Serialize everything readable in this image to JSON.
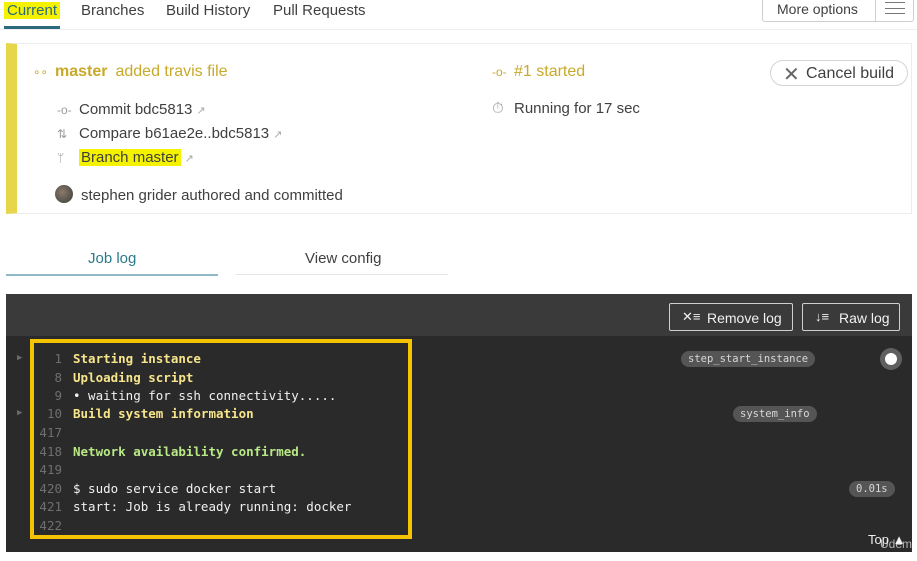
{
  "nav": {
    "tabs": [
      "Current",
      "Branches",
      "Build History",
      "Pull Requests"
    ],
    "more_options": "More options"
  },
  "build": {
    "branch": "master",
    "message": "added travis file",
    "commit": "Commit bdc5813",
    "compare": "Compare b61ae2e..bdc5813",
    "branch_link": "Branch master",
    "author": "stephen grider authored and committed",
    "status": "#1 started",
    "running": "Running for 17 sec",
    "cancel": "Cancel build"
  },
  "log_tabs": [
    "Job log",
    "View config"
  ],
  "terminal": {
    "remove_log": "Remove log",
    "raw_log": "Raw log",
    "lines": [
      {
        "num": "1",
        "text": "Starting instance",
        "style": "yellow",
        "fold": true,
        "tag": "step_start_instance"
      },
      {
        "num": "8",
        "text": "Uploading script",
        "style": "yellow",
        "fold": false,
        "tag": ""
      },
      {
        "num": "9",
        "text": "• waiting for ssh connectivity.....",
        "style": "plain",
        "fold": false,
        "tag": ""
      },
      {
        "num": "10",
        "text": "Build system information",
        "style": "yellow",
        "fold": true,
        "tag": "system_info"
      },
      {
        "num": "417",
        "text": "",
        "style": "plain",
        "fold": false,
        "tag": ""
      },
      {
        "num": "418",
        "text": "Network availability confirmed.",
        "style": "green",
        "fold": false,
        "tag": ""
      },
      {
        "num": "419",
        "text": "",
        "style": "plain",
        "fold": false,
        "tag": ""
      },
      {
        "num": "420",
        "text": "$ sudo service docker start",
        "style": "plain",
        "fold": false,
        "tag": "0.01s"
      },
      {
        "num": "421",
        "text": "start: Job is already running: docker",
        "style": "plain",
        "fold": false,
        "tag": ""
      },
      {
        "num": "422",
        "text": "",
        "style": "plain",
        "fold": false,
        "tag": ""
      }
    ],
    "top_link": "Top",
    "watermark": "Udemy"
  },
  "colors": {
    "accent": "#2a6a7a",
    "build_status": "#c9a92a",
    "highlight": "#f5f200",
    "annotation_box": "#f5c300",
    "terminal_bg": "#2a2a2a"
  }
}
